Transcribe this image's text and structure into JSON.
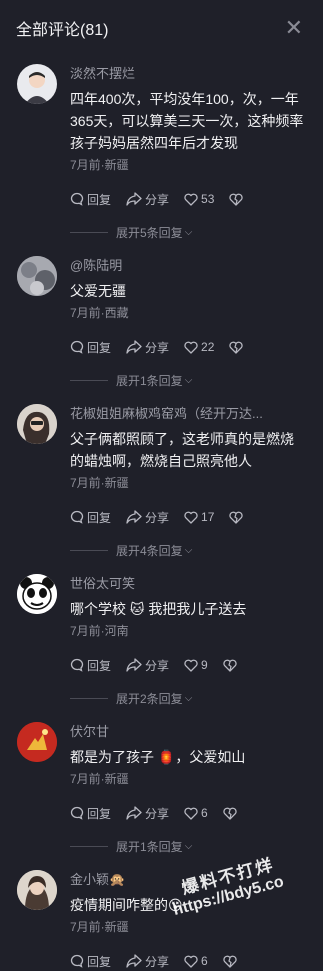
{
  "header": {
    "title": "全部评论(81)",
    "close_icon": "close-icon"
  },
  "comments": [
    {
      "author": "淡然不摆烂",
      "text": "四年400次，平均没年100，次，一年365天，可以算美三天一次，这种频率孩子妈妈居然四年后才发现",
      "meta": "7月前·新疆",
      "reply": "回复",
      "share": "分享",
      "likes": "53",
      "expand": "展开5条回复"
    },
    {
      "author": "@陈陆明",
      "text": "父爱无疆",
      "meta": "7月前·西藏",
      "reply": "回复",
      "share": "分享",
      "likes": "22",
      "expand": "展开1条回复"
    },
    {
      "author": "花椒姐姐麻椒鸡窑鸡（经开万达...",
      "text": "父子俩都照顾了，这老师真的是燃烧的蜡烛啊，燃烧自己照亮他人",
      "meta": "7月前·新疆",
      "reply": "回复",
      "share": "分享",
      "likes": "17",
      "expand": "展开4条回复"
    },
    {
      "author": "世俗太可笑",
      "text": "哪个学校 🐱 我把我儿子送去",
      "meta": "7月前·河南",
      "reply": "回复",
      "share": "分享",
      "likes": "9",
      "expand": "展开2条回复"
    },
    {
      "author": "伏尔甘",
      "text": "都是为了孩子 🏮，父爱如山",
      "meta": "7月前·新疆",
      "reply": "回复",
      "share": "分享",
      "likes": "6",
      "expand": "展开1条回复"
    },
    {
      "author": "金小颖🙊",
      "text": "疫情期间咋整的😵",
      "meta": "7月前·新疆",
      "reply": "回复",
      "share": "分享",
      "likes": "6",
      "expand": ""
    }
  ],
  "watermark": {
    "line1": "爆料不打烊",
    "line2": "https://bdy5.co"
  },
  "colors": {
    "background": "#1f2029",
    "text": "#f0f0f2",
    "muted": "#8c8d97"
  }
}
